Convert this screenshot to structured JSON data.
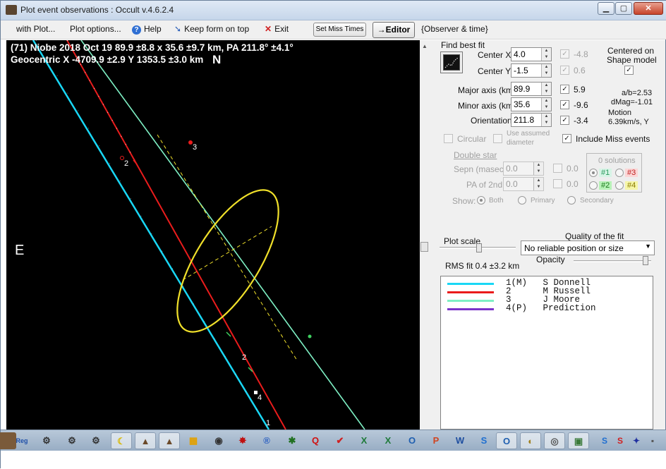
{
  "window": {
    "title": "Plot event observations : Occult v.4.6.2.4"
  },
  "menu": {
    "items": [
      "with Plot...",
      "Plot options...",
      "Help",
      "Keep form on top",
      "Exit"
    ],
    "set_miss_times": "Set Miss Times",
    "editor": "→Editor",
    "observer_time": "{Observer & time}"
  },
  "plot": {
    "line1": "(71) Niobe  2018 Oct 19   89.9 ±8.8 x 35.6 ±9.7 km, PA 211.8° ±4.1°",
    "line2": "Geocentric  X  -4709.9 ±2.9  Y 1353.5 ±3.0 km",
    "north": "N",
    "east": "E",
    "chord_labels": [
      "3",
      "2",
      "2",
      "4",
      "1"
    ]
  },
  "fit": {
    "find_best_fit": "Find best fit",
    "center_x_label": "Center X",
    "center_x": "4.0",
    "center_x_delta": "-4.8",
    "center_y_label": "Center Y",
    "center_y": "-1.5",
    "center_y_delta": "0.6",
    "centered_on": "Centered on",
    "shape_model": "Shape model",
    "major_label": "Major axis (km)",
    "major": "89.9",
    "major_delta": "5.9",
    "minor_label": "Minor axis (km)",
    "minor": "35.6",
    "minor_delta": "-9.6",
    "orient_label": "Orientation",
    "orient": "211.8",
    "orient_delta": "-3.4",
    "ab": "a/b=2.53",
    "dmag": "dMag=-1.01",
    "motion_label": "Motion",
    "motion": "6.39km/s, Y",
    "circular": "Circular",
    "use_assumed": "Use assumed",
    "diameter": "diameter",
    "include_miss": "Include Miss events"
  },
  "double_star": {
    "title": "Double star",
    "sepn_label": "Sepn (masec)",
    "sepn": "0.0",
    "sepn_delta": "0.0",
    "pa_label": "PA of 2nd",
    "pa": "0.0",
    "pa_delta": "0.0",
    "show_label": "Show:",
    "show_options": [
      "Both",
      "Primary",
      "Secondary"
    ],
    "solutions": "0 solutions",
    "sol_1": "#1",
    "sol_2": "#2",
    "sol_3": "#3",
    "sol_4": "#4"
  },
  "scale": {
    "plot_scale": "Plot scale",
    "quality_label": "Quality of the fit",
    "quality_value": "No reliable position or size",
    "opacity": "Opacity",
    "rms": "RMS fit  0.4 ±3.2 km"
  },
  "legend": [
    {
      "num": "1(M)",
      "name": "S Donnell",
      "color": "#19d7f5"
    },
    {
      "num": "2",
      "name": "M Russell",
      "color": "#ea1c1c"
    },
    {
      "num": "3",
      "name": "J Moore",
      "color": "#7ef0c4"
    },
    {
      "num": "4(P)",
      "name": "Prediction",
      "color": "#7a33c9"
    }
  ]
}
